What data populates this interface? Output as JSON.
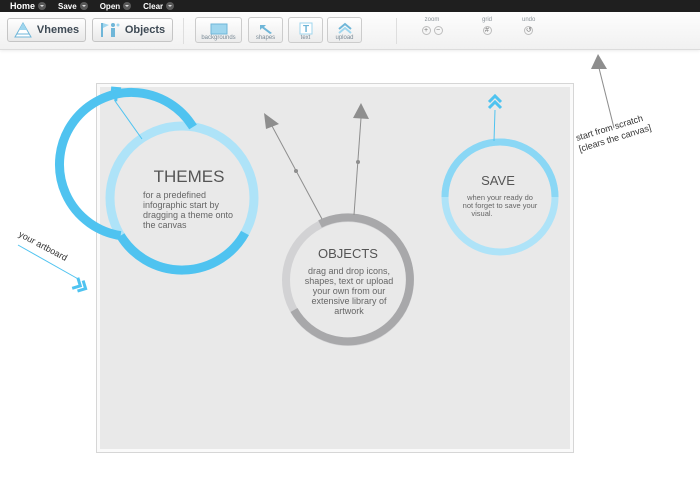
{
  "menu": {
    "items": [
      {
        "label": "Home"
      },
      {
        "label": "Save"
      },
      {
        "label": "Open"
      },
      {
        "label": "Clear"
      }
    ]
  },
  "toolbar": {
    "themes_label": "Vhemes",
    "objects_label": "Objects",
    "backgrounds_label": "backgrounds",
    "shapes_label": "shapes",
    "text_label": "text",
    "upload_label": "upload",
    "zoom_label": "zoom",
    "grid_label": "grid",
    "undo_label": "undo"
  },
  "artboard": {
    "themes": {
      "title": "THEMES",
      "lines": [
        "for a predefined",
        "infographic start by",
        "dragging a theme onto",
        "the canvas"
      ]
    },
    "objects": {
      "title": "OBJECTS",
      "lines": [
        "drag and drop icons,",
        "shapes, text or upload",
        "your own from our",
        "extensive library of",
        "artwork"
      ]
    },
    "save": {
      "title": "SAVE",
      "lines": [
        "when your ready do",
        "not forget to save your",
        "visual."
      ]
    }
  },
  "annotations": {
    "artboard_label": "your artboard",
    "scratch_line1": "start from scratch",
    "scratch_line2": "[clears the canvas]"
  },
  "colors": {
    "accent_blue": "#4fc3f0",
    "light_blue": "#aee3f8",
    "mid_blue": "#8ad7f5",
    "gray_ring": "#a8a8aa",
    "light_gray_ring": "#d2d2d4",
    "arrow_gray": "#8e8e8e"
  }
}
